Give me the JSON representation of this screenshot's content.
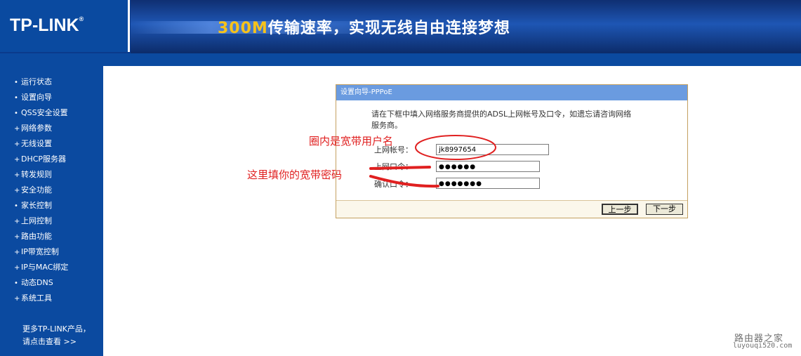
{
  "header": {
    "logo": "TP-LINK",
    "logo_mark": "®",
    "slogan_highlight": "300M",
    "slogan_rest": "传输速率，实现无线自由连接梦想"
  },
  "sidebar": {
    "items": [
      {
        "label": "运行状态",
        "bullet": "•"
      },
      {
        "label": "设置向导",
        "bullet": "•"
      },
      {
        "label": "QSS安全设置",
        "bullet": "•"
      },
      {
        "label": "网络参数",
        "bullet": "+"
      },
      {
        "label": "无线设置",
        "bullet": "+"
      },
      {
        "label": "DHCP服务器",
        "bullet": "+"
      },
      {
        "label": "转发规则",
        "bullet": "+"
      },
      {
        "label": "安全功能",
        "bullet": "+"
      },
      {
        "label": "家长控制",
        "bullet": "•"
      },
      {
        "label": "上网控制",
        "bullet": "+"
      },
      {
        "label": "路由功能",
        "bullet": "+"
      },
      {
        "label": "IP带宽控制",
        "bullet": "+"
      },
      {
        "label": "IP与MAC绑定",
        "bullet": "+"
      },
      {
        "label": "动态DNS",
        "bullet": "•"
      },
      {
        "label": "系统工具",
        "bullet": "+"
      }
    ],
    "more_line1": "更多TP-LINK产品，",
    "more_line2": "请点击查看 >>"
  },
  "wizard": {
    "title": "设置向导-PPPoE",
    "description_line1": "请在下框中填入网络服务商提供的ADSL上网帐号及口令，如遗忘请咨询网络",
    "description_line2": "服务商。",
    "account_label": "上网帐号：",
    "account_value": "jk8997654",
    "password_label": "上网口令：",
    "password_value": "●●●●●●",
    "confirm_label": "确认口令：",
    "confirm_value": "●●●●●●●",
    "prev_button": "上一步",
    "next_button": "下一步"
  },
  "annotations": {
    "username_note": "圈内是宽带用户名",
    "password_note": "这里填你的宽带密码",
    "color": "#e02020"
  },
  "watermark": {
    "name": "路由器之家",
    "url": "luyouqi520.com"
  }
}
